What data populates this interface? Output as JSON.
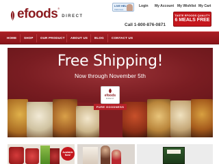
{
  "brand": {
    "name": "efoods",
    "trademark": "®",
    "suffix": "DIRECT"
  },
  "live_help": {
    "line1": "LIVE HELP",
    "line2": "Click here"
  },
  "top_links": {
    "login": "Login",
    "account": "My Account",
    "wishlist": "My Wishlist",
    "cart": "My Cart"
  },
  "promo": {
    "line1": "TASTE EFOODS QUALITY",
    "line2": "6 MEALS FREE"
  },
  "phone": "Call 1-800-876-0871",
  "nav": {
    "items": [
      "HOME",
      "SHOP",
      "OUR PRODUCT",
      "ABOUT US",
      "BLOG",
      "CONTACT US"
    ]
  },
  "hero": {
    "headline": "Free Shipping!",
    "subline": "Now through November 5th",
    "badge_brand": "efoods",
    "badge_sub": "DIRECT",
    "ribbon": "PURE GOODNESS"
  },
  "thumbs": {
    "available_badge": "Available Now!"
  },
  "colors": {
    "brand_red": "#8b1b1f",
    "nav_red": "#a71f25",
    "promo_red": "#c4161c",
    "hero_bg": "#7e1e22"
  }
}
